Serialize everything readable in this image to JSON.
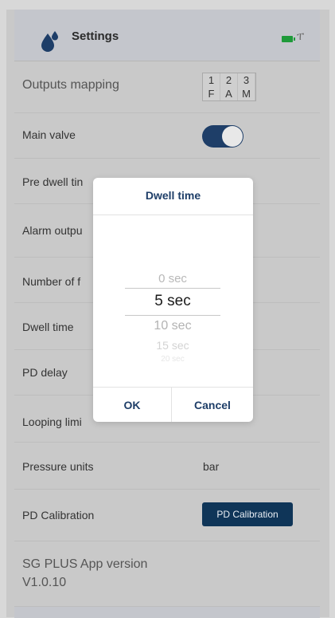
{
  "header": {
    "title": "Settings",
    "icons": [
      "water-drop-icon",
      "battery-icon",
      "antenna-icon"
    ]
  },
  "rows": {
    "outputs_mapping": {
      "label": "Outputs mapping",
      "numbers": [
        "1",
        "2",
        "3"
      ],
      "letters": [
        "F",
        "A",
        "M"
      ]
    },
    "main_valve": {
      "label": "Main valve",
      "toggle_on": true
    },
    "pre_dwell": {
      "label": "Pre dwell tin"
    },
    "alarm_output": {
      "label": "Alarm outpu"
    },
    "number_of": {
      "label": "Number of f"
    },
    "dwell_time": {
      "label": "Dwell time"
    },
    "pd_delay": {
      "label": "PD delay"
    },
    "looping_limit": {
      "label": "Looping limi"
    },
    "pressure_units": {
      "label": "Pressure units",
      "value": "bar"
    },
    "pd_calibration": {
      "label": "PD Calibration",
      "button_label": "PD Calibration"
    },
    "app_version": {
      "label": "SG PLUS App version",
      "value": "V1.0.10"
    }
  },
  "dialog": {
    "title": "Dwell time",
    "picker_options": [
      "0 sec",
      "5 sec",
      "10 sec",
      "15 sec",
      "20 sec"
    ],
    "selected": "5 sec",
    "ok_label": "OK",
    "cancel_label": "Cancel"
  },
  "colors": {
    "accent": "#1e3e68",
    "button": "#0f3558",
    "battery": "#1f9a3a"
  }
}
